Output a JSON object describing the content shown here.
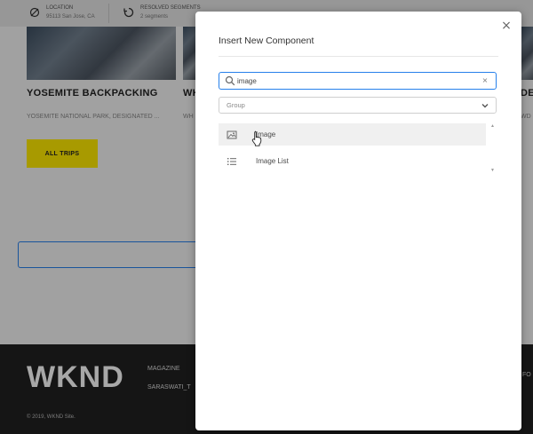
{
  "context_bar": {
    "location_label": "LOCATION",
    "location_value": "95113 San Jose, CA",
    "segments_label": "RESOLVED SEGMENTS",
    "segments_value": "2 segments"
  },
  "page": {
    "cards": [
      {
        "title": "YOSEMITE BACKPACKING",
        "subtitle": "YOSEMITE NATIONAL PARK, DESIGNATED ..."
      },
      {
        "title": "WH",
        "subtitle": "WH"
      },
      {
        "title": "DE S",
        "subtitle": "WD"
      }
    ],
    "all_trips_label": "ALL TRIPS"
  },
  "footer": {
    "logo": "WKND",
    "link_magazine": "MAGAZINE",
    "link_user": "SARASWATI_T",
    "link_right": "FO",
    "copyright": "2019, WKND Site."
  },
  "dialog": {
    "title": "Insert New Component",
    "close_glyph": "×",
    "search": {
      "value": "image",
      "clear_glyph": "×"
    },
    "group": {
      "label": "Group"
    },
    "results": [
      {
        "label": "Image",
        "icon": "image-icon"
      },
      {
        "label": "Image List",
        "icon": "list-icon"
      }
    ]
  },
  "colors": {
    "accent": "#2680eb",
    "button_yellow": "#ffea00",
    "footer_bg": "#202020"
  }
}
